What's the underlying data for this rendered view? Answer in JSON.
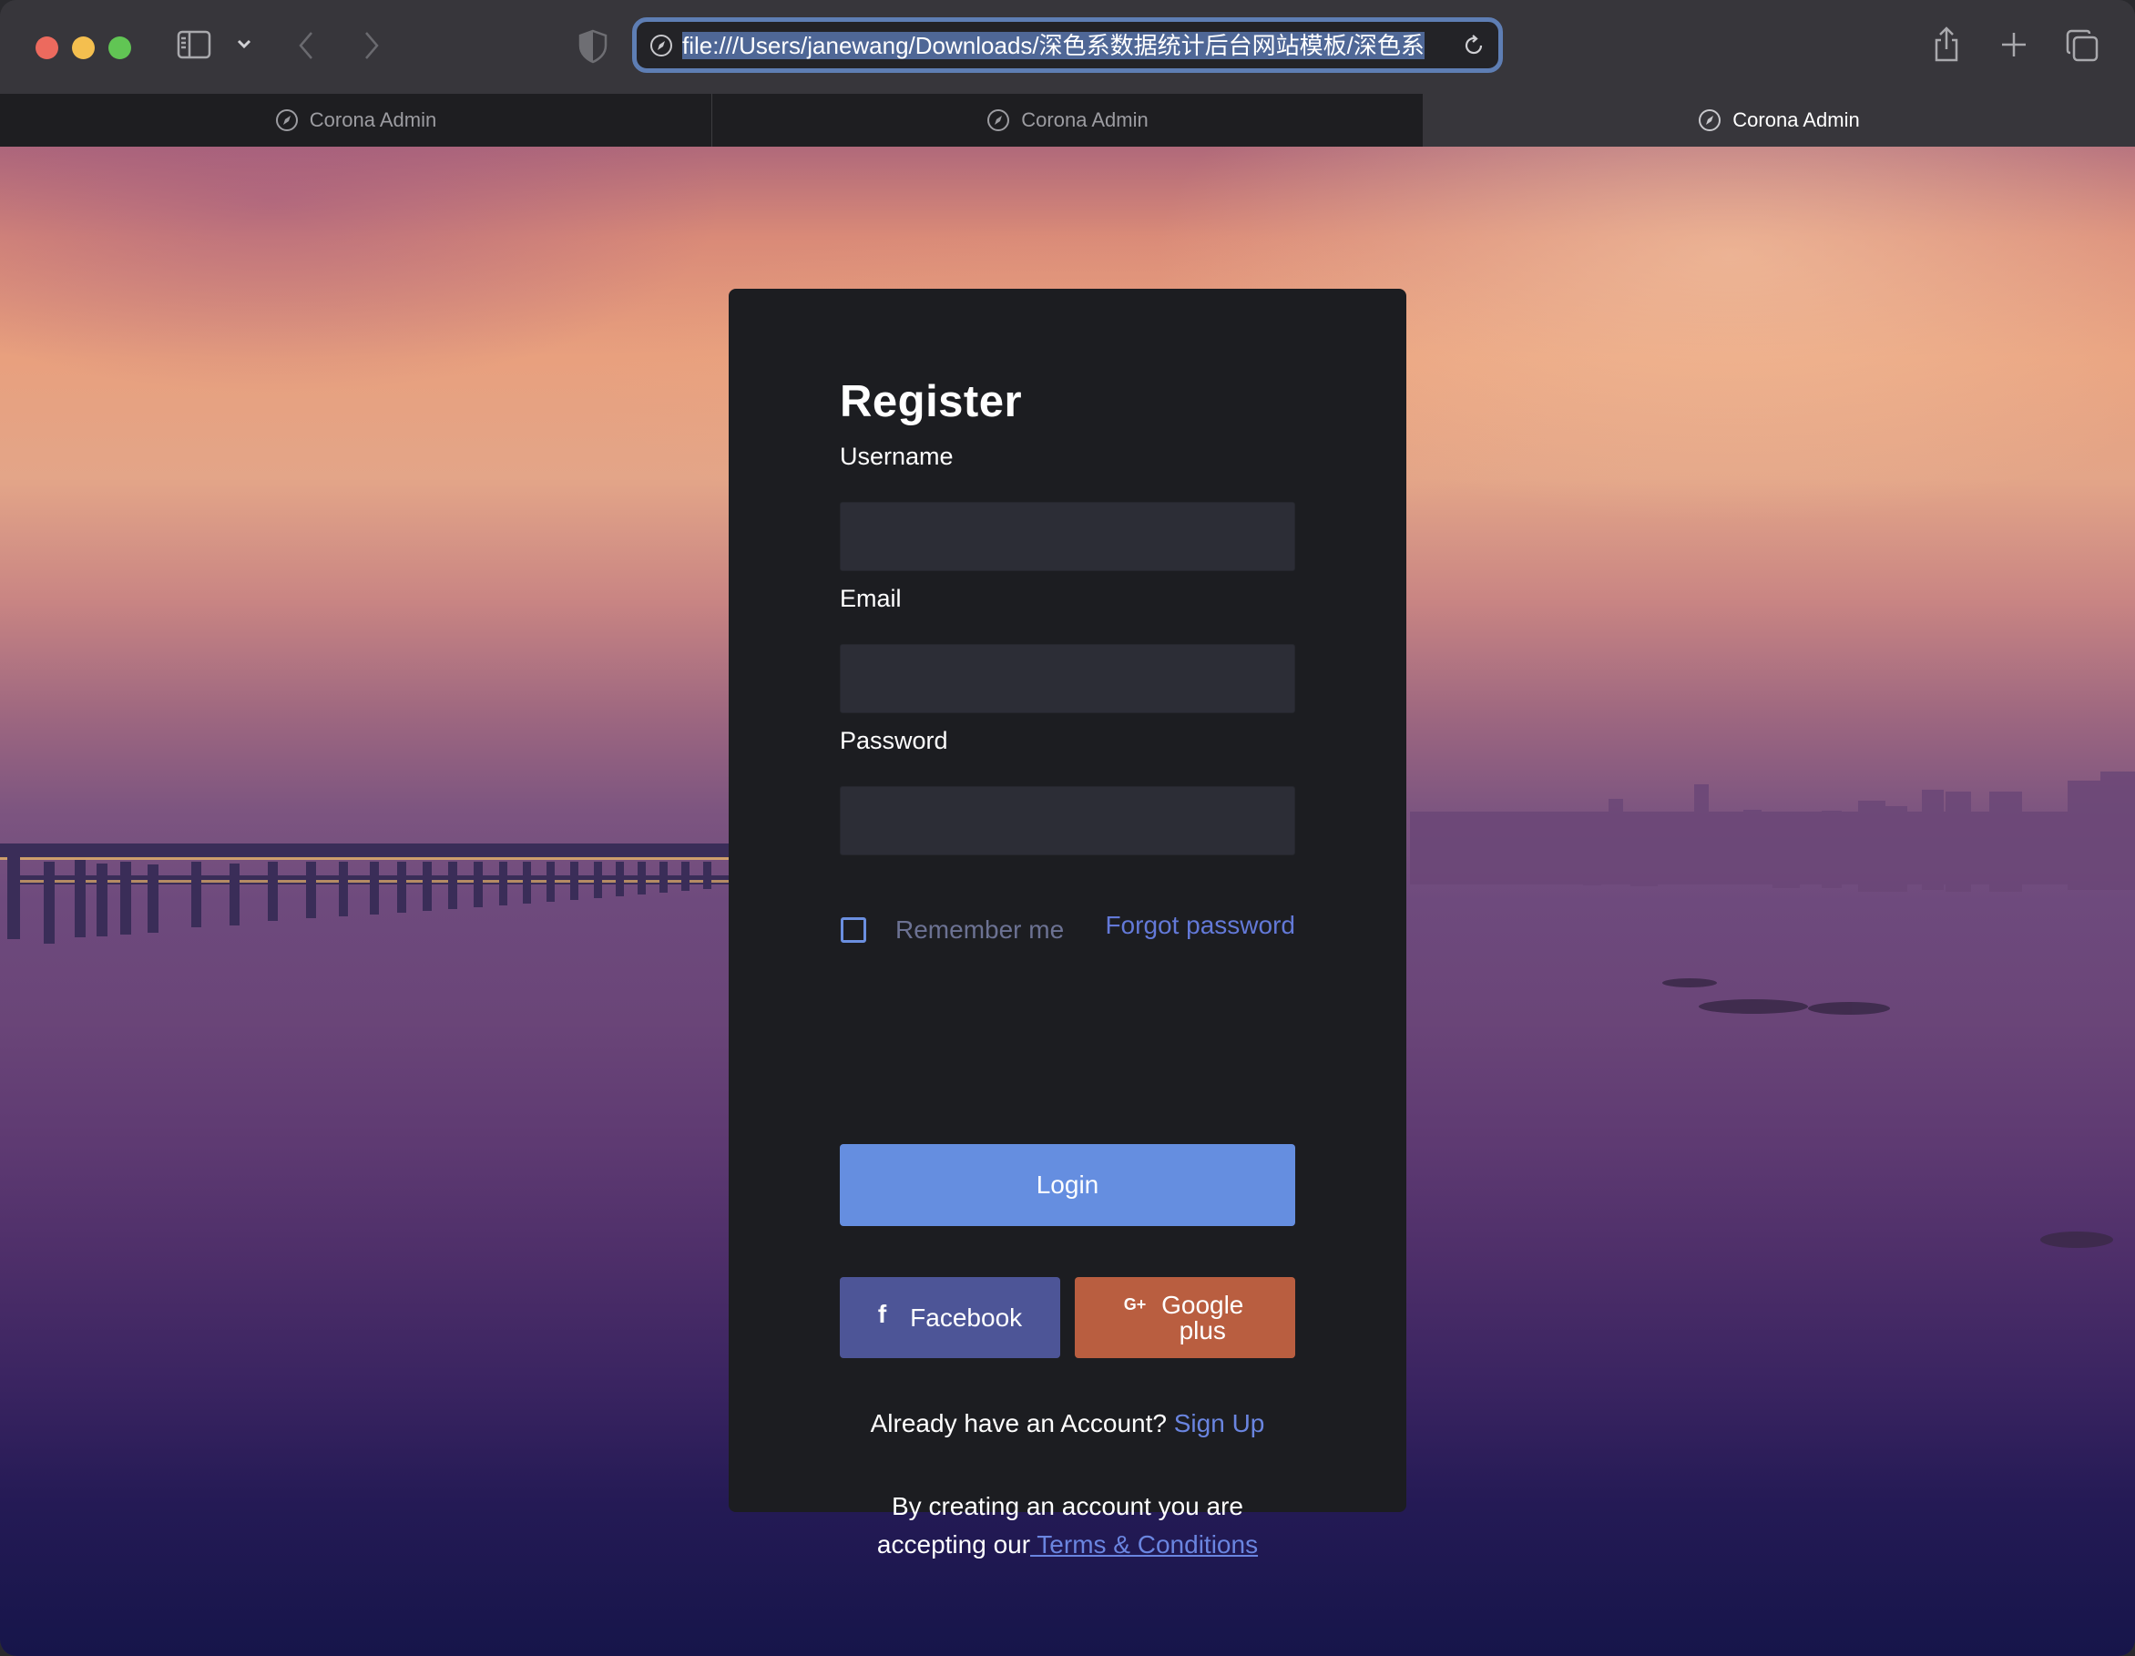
{
  "browser": {
    "url": "file:///Users/janewang/Downloads/深色系数据统计后台网站模板/深色系",
    "tabs": [
      {
        "label": "Corona Admin",
        "active": false
      },
      {
        "label": "Corona Admin",
        "active": false
      },
      {
        "label": "Corona Admin",
        "active": true
      }
    ],
    "icons": {
      "sidebar": "sidebar-icon",
      "tab_group_menu": "chevron-down-icon",
      "back": "chevron-left-icon",
      "forward": "chevron-right-icon",
      "privacy": "shield-icon",
      "url_site": "compass-icon",
      "reload": "reload-icon",
      "share": "share-icon",
      "new_tab": "plus-icon",
      "tab_overview": "tabs-icon"
    }
  },
  "register": {
    "title": "Register",
    "fields": {
      "username": {
        "label": "Username",
        "value": "",
        "placeholder": ""
      },
      "email": {
        "label": "Email",
        "value": "",
        "placeholder": ""
      },
      "password": {
        "label": "Password",
        "value": "",
        "placeholder": ""
      }
    },
    "remember_me": {
      "label": "Remember me",
      "checked": false
    },
    "forgot_password": "Forgot password",
    "login_button": "Login",
    "social": {
      "facebook": {
        "label": "Facebook",
        "icon": "facebook-icon",
        "glyph": "f"
      },
      "google": {
        "label_line1": "Google",
        "label_line2": "plus",
        "icon": "google-plus-icon",
        "glyph": "G+"
      }
    },
    "already_text": "Already have an Account?",
    "sign_up_link": "Sign Up",
    "terms_text_1": "By creating an account you are",
    "terms_text_2": "accepting our",
    "terms_link": " Terms & Conditions"
  },
  "colors": {
    "card_bg": "#1c1d21",
    "input_bg": "#2c2d36",
    "primary": "#658ee0",
    "link": "#6a85e0",
    "facebook": "#4d5597",
    "google_plus": "#b95e40",
    "muted_text": "#6c7293"
  }
}
